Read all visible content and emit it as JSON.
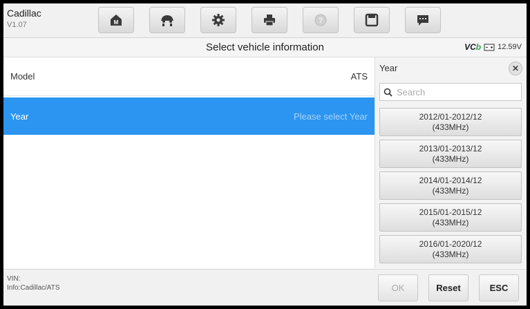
{
  "header": {
    "brand": "Cadillac",
    "version": "V1.07",
    "toolbar": [
      {
        "icon": "home-icon"
      },
      {
        "icon": "vehicle-lift-icon"
      },
      {
        "icon": "gear-icon"
      },
      {
        "icon": "printer-icon"
      },
      {
        "icon": "help-icon"
      },
      {
        "icon": "save-icon"
      },
      {
        "icon": "message-icon"
      }
    ]
  },
  "titlebar": {
    "title": "Select vehicle information",
    "vci_logo": "VCb",
    "voltage": "12.59V"
  },
  "main": {
    "rows": [
      {
        "label": "Model",
        "value": "ATS"
      },
      {
        "label": "Year",
        "value": "Please select Year"
      }
    ]
  },
  "panel": {
    "title": "Year",
    "search_placeholder": "Search",
    "options": [
      {
        "line1": "2012/01-2012/12",
        "line2": "(433MHz)"
      },
      {
        "line1": "2013/01-2013/12",
        "line2": "(433MHz)"
      },
      {
        "line1": "2014/01-2014/12",
        "line2": "(433MHz)"
      },
      {
        "line1": "2015/01-2015/12",
        "line2": "(433MHz)"
      },
      {
        "line1": "2016/01-2020/12",
        "line2": "(433MHz)"
      }
    ]
  },
  "footer": {
    "vin_label": "VIN:",
    "info": "Info:Cadillac/ATS",
    "ok": "OK",
    "reset": "Reset",
    "esc": "ESC"
  },
  "colors": {
    "selected_row": "#2b95f1",
    "placeholder_on_selected": "#a9d2f7",
    "battery_green": "#2aa44a"
  }
}
